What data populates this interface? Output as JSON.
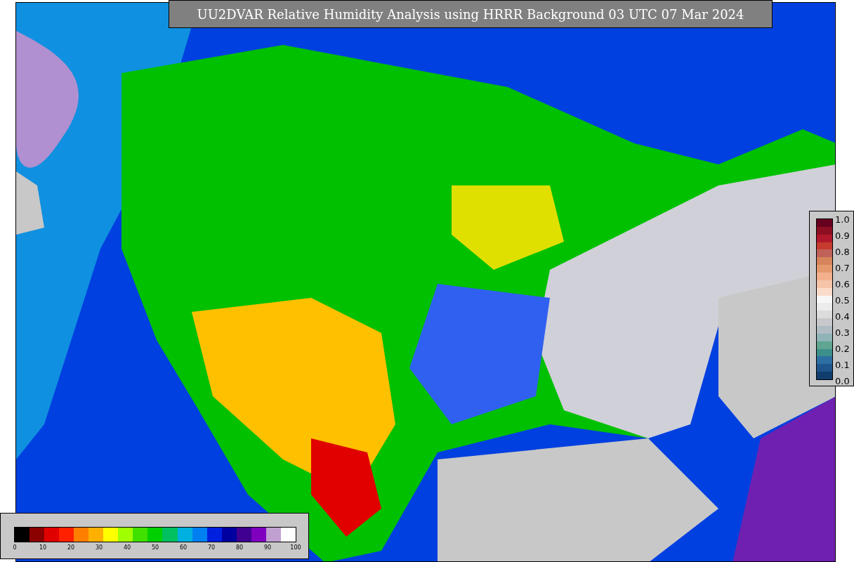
{
  "title": "UU2DVAR Relative Humidity Analysis using HRRR Background 03 UTC 07 Mar 2024",
  "right_colorbar": {
    "ticks": [
      "1.0",
      "0.9",
      "0.8",
      "0.7",
      "0.6",
      "0.5",
      "0.4",
      "0.3",
      "0.2",
      "0.1",
      "0.0"
    ],
    "bands": [
      {
        "color": "#67001f"
      },
      {
        "color": "#8e0f22"
      },
      {
        "color": "#b2182b"
      },
      {
        "color": "#c63b2d"
      },
      {
        "color": "#c0625a"
      },
      {
        "color": "#d6845c"
      },
      {
        "color": "#e59a6e"
      },
      {
        "color": "#f4b08c"
      },
      {
        "color": "#f6c4a8"
      },
      {
        "color": "#fbdccb"
      },
      {
        "color": "#f7f7f7"
      },
      {
        "color": "#ececec"
      },
      {
        "color": "#dcdcdc"
      },
      {
        "color": "#c8c8cc"
      },
      {
        "color": "#b0bcc4"
      },
      {
        "color": "#8fb3b6"
      },
      {
        "color": "#5fa592"
      },
      {
        "color": "#3c8f8a"
      },
      {
        "color": "#2d6fa3"
      },
      {
        "color": "#1e558c"
      },
      {
        "color": "#123e6e"
      }
    ]
  },
  "bottom_colorbar": {
    "ticks": [
      "0",
      "10",
      "20",
      "30",
      "40",
      "50",
      "60",
      "70",
      "80",
      "90",
      "100"
    ],
    "bands": [
      {
        "color": "#000000"
      },
      {
        "color": "#8b0000"
      },
      {
        "color": "#e00000"
      },
      {
        "color": "#ff2000"
      },
      {
        "color": "#ff8000"
      },
      {
        "color": "#ffb000"
      },
      {
        "color": "#ffff00"
      },
      {
        "color": "#a0ff00"
      },
      {
        "color": "#40e000"
      },
      {
        "color": "#00d000"
      },
      {
        "color": "#00c060"
      },
      {
        "color": "#00b0e0"
      },
      {
        "color": "#0080f0"
      },
      {
        "color": "#0020e0"
      },
      {
        "color": "#0000a0"
      },
      {
        "color": "#400090"
      },
      {
        "color": "#8000c0"
      },
      {
        "color": "#c0a0d0"
      },
      {
        "color": "#ffffff"
      }
    ]
  }
}
